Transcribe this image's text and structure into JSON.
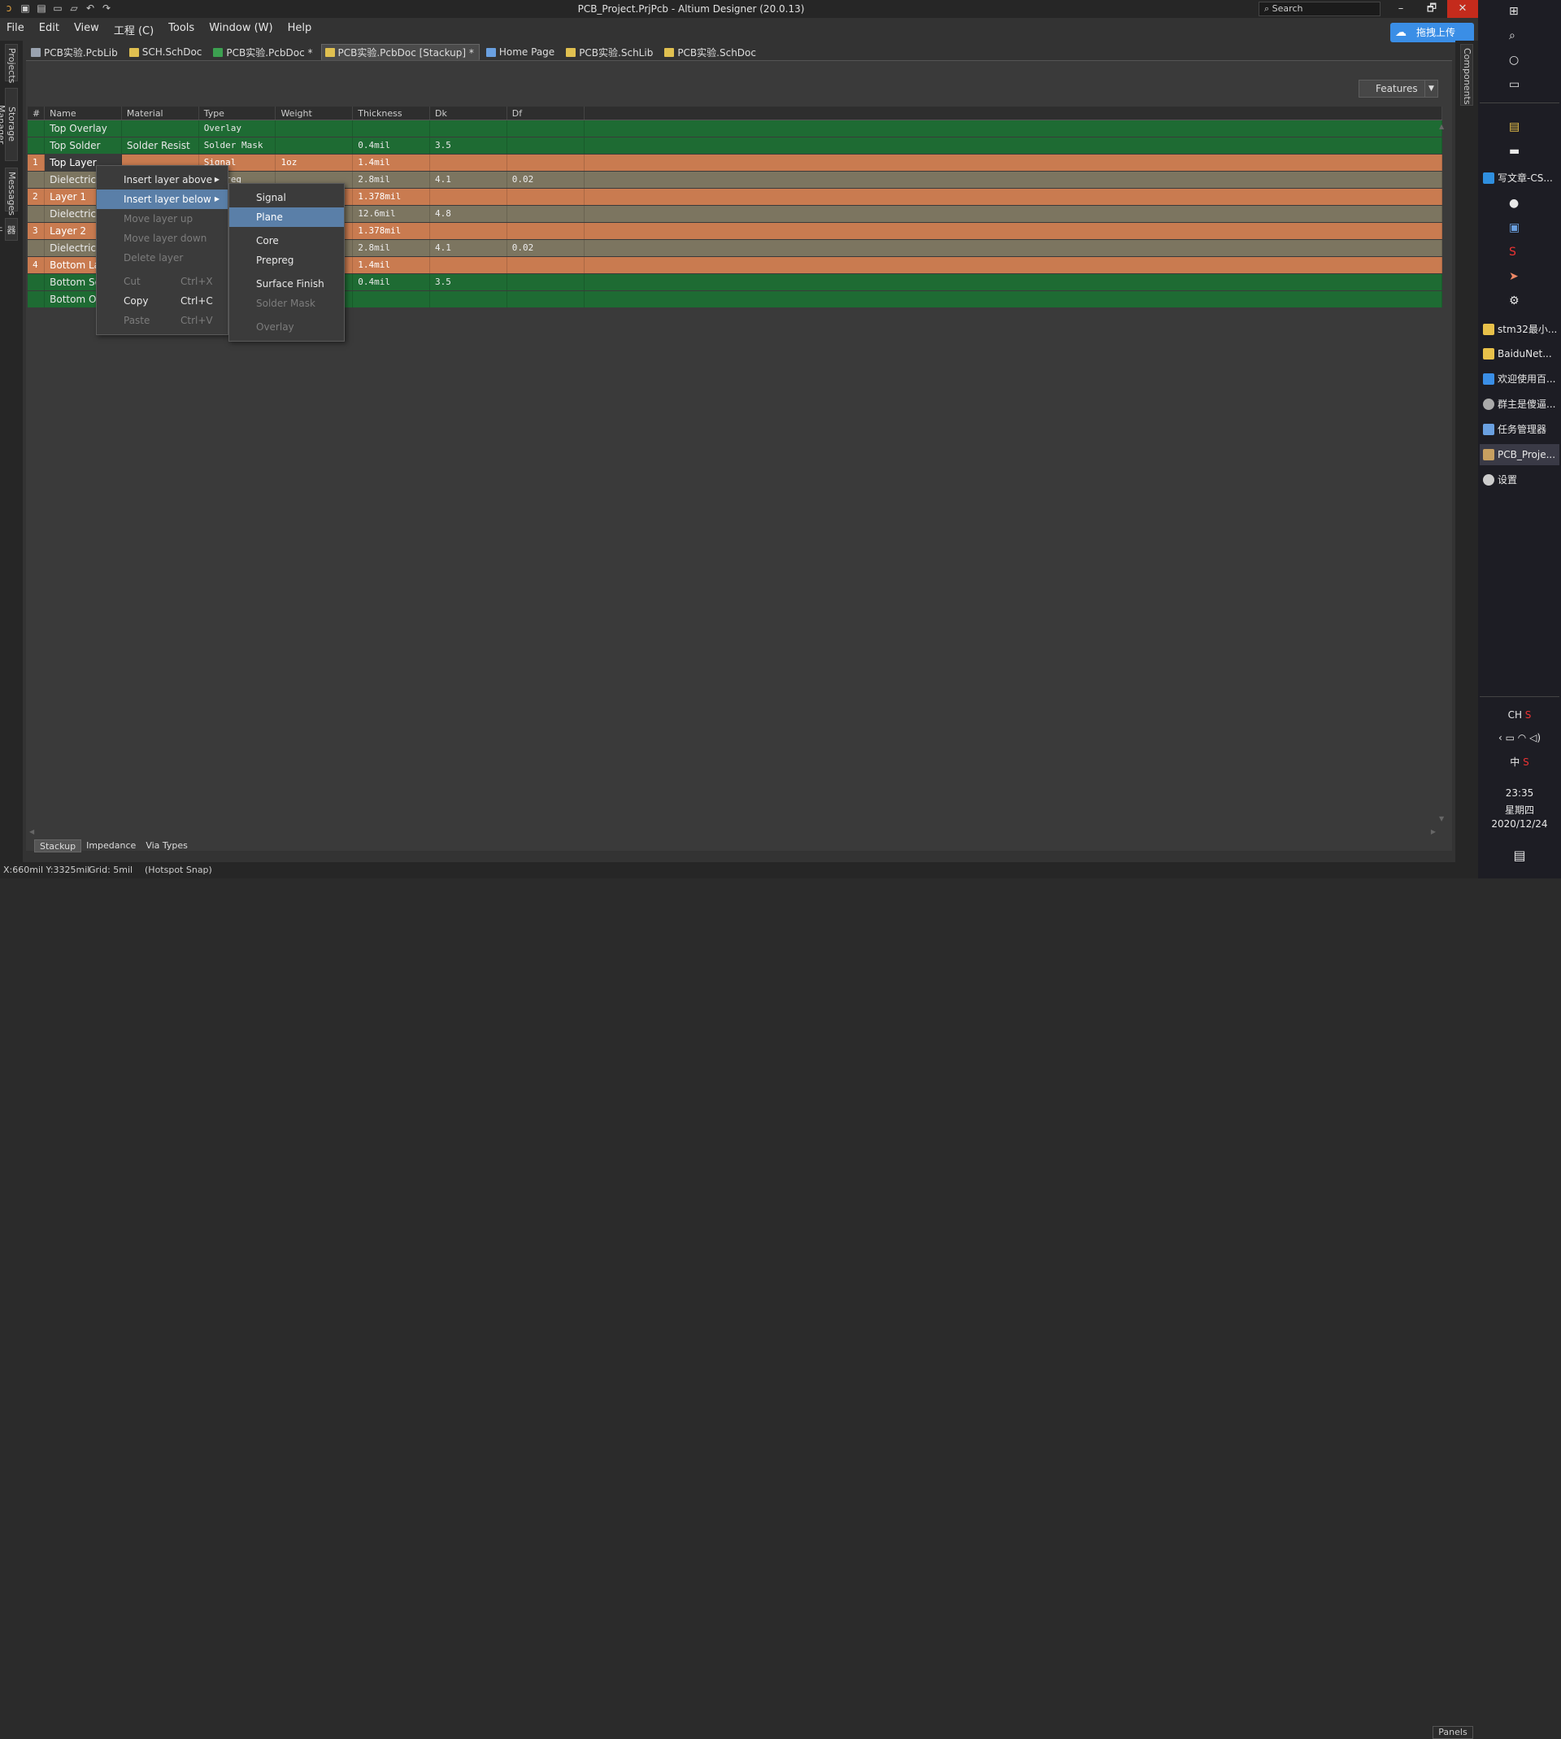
{
  "window": {
    "title": "PCB_Project.PrjPcb - Altium Designer (20.0.13)",
    "search_placeholder": "Search",
    "minimize": "–",
    "restore": "🗗",
    "close": "✕"
  },
  "menu": [
    "File",
    "Edit",
    "View",
    "工程 (C)",
    "Tools",
    "Window (W)",
    "Help"
  ],
  "upload_button": "拖拽上传",
  "left_panels": [
    "Projects",
    "Storage Manager",
    "Messages",
    "器件"
  ],
  "right_panels": [
    "Components"
  ],
  "doc_tabs": [
    {
      "label": "PCB实验.PcbLib",
      "icon": "pcblib-icon",
      "color": "#9aa3b0"
    },
    {
      "label": "SCH.SchDoc",
      "icon": "schdoc-icon",
      "color": "#e0c050"
    },
    {
      "label": "PCB实验.PcbDoc *",
      "icon": "pcbdoc-icon",
      "color": "#3ca050"
    },
    {
      "label": "PCB实验.PcbDoc [Stackup] *",
      "icon": "stackup-icon",
      "color": "#e0c050",
      "active": true
    },
    {
      "label": "Home Page",
      "icon": "home-icon",
      "color": "#6aa0e0"
    },
    {
      "label": "PCB实验.SchLib",
      "icon": "schlib-icon",
      "color": "#e0c050"
    },
    {
      "label": "PCB实验.SchDoc",
      "icon": "schdoc-icon",
      "color": "#e0c050"
    }
  ],
  "features_button": "Features",
  "columns": [
    "#",
    "Name",
    "Material",
    "Type",
    "Weight",
    "Thickness",
    "Dk",
    "Df"
  ],
  "layers": [
    {
      "num": "",
      "name": "Top Overlay",
      "material": "",
      "type": "Overlay",
      "weight": "",
      "thickness": "",
      "dk": "",
      "df": "",
      "style": "g"
    },
    {
      "num": "",
      "name": "Top Solder",
      "material": "Solder Resist",
      "type": "Solder Mask",
      "weight": "",
      "thickness": "0.4mil",
      "dk": "3.5",
      "df": "",
      "style": "g"
    },
    {
      "num": "1",
      "name": "Top Layer",
      "material": "",
      "type": "Signal",
      "weight": "1oz",
      "thickness": "1.4mil",
      "dk": "",
      "df": "",
      "style": "o"
    },
    {
      "num": "",
      "name": "Dielectric 2",
      "material": "",
      "type": "Prepreg",
      "weight": "",
      "thickness": "2.8mil",
      "dk": "4.1",
      "df": "0.02",
      "style": "d"
    },
    {
      "num": "2",
      "name": "Layer 1",
      "material": "",
      "type": "",
      "weight": "",
      "thickness": "1.378mil",
      "dk": "",
      "df": "",
      "style": "o"
    },
    {
      "num": "",
      "name": "Dielectric 1",
      "material": "",
      "type": "",
      "weight": "",
      "thickness": "12.6mil",
      "dk": "4.8",
      "df": "",
      "style": "d"
    },
    {
      "num": "3",
      "name": "Layer 2",
      "material": "",
      "type": "",
      "weight": "",
      "thickness": "1.378mil",
      "dk": "",
      "df": "",
      "style": "o"
    },
    {
      "num": "",
      "name": "Dielectric 3",
      "material": "",
      "type": "",
      "weight": "",
      "thickness": "2.8mil",
      "dk": "4.1",
      "df": "0.02",
      "style": "d"
    },
    {
      "num": "4",
      "name": "Bottom Layer",
      "material": "",
      "type": "",
      "weight": "",
      "thickness": "1.4mil",
      "dk": "",
      "df": "",
      "style": "o"
    },
    {
      "num": "",
      "name": "Bottom Solder",
      "material": "",
      "type": "",
      "weight": "",
      "thickness": "0.4mil",
      "dk": "3.5",
      "df": "",
      "style": "g"
    },
    {
      "num": "",
      "name": "Bottom Overlay",
      "material": "",
      "type": "",
      "weight": "",
      "thickness": "",
      "dk": "",
      "df": "",
      "style": "g"
    }
  ],
  "context_menu": {
    "insert_above": "Insert layer above",
    "insert_below": "Insert layer below",
    "move_up": "Move layer up",
    "move_down": "Move layer down",
    "delete": "Delete layer",
    "cut": "Cut",
    "cut_shortcut": "Ctrl+X",
    "copy": "Copy",
    "copy_shortcut": "Ctrl+C",
    "paste": "Paste",
    "paste_shortcut": "Ctrl+V"
  },
  "submenu": {
    "signal": "Signal",
    "plane": "Plane",
    "core": "Core",
    "prepreg": "Prepreg",
    "surface_finish": "Surface Finish",
    "solder_mask": "Solder Mask",
    "overlay": "Overlay"
  },
  "bottom_tabs": [
    "Stackup",
    "Impedance",
    "Via Types"
  ],
  "status": {
    "coords": "X:660mil Y:3325mil",
    "grid": "Grid: 5mil",
    "snap": "(Hotspot Snap)",
    "panels": "Panels"
  },
  "taskbar": {
    "apps": [
      {
        "label": "写文章-CS...",
        "color": "#2f8fdf"
      },
      {
        "label": "stm32最小...",
        "color": "#e8c14a"
      },
      {
        "label": "BaiduNet...",
        "color": "#e8c14a"
      },
      {
        "label": "欢迎使用百...",
        "color": "#3a8ee6"
      },
      {
        "label": "群主是傻逼...",
        "color": "#aaa"
      },
      {
        "label": "任务管理器",
        "color": "#6aa0e0"
      },
      {
        "label": "PCB_Proje...",
        "color": "#c8a060",
        "active": true
      },
      {
        "label": "设置",
        "color": "#ccc"
      }
    ],
    "ime": "CH",
    "ime2": "中",
    "time": "23:35",
    "weekday": "星期四",
    "date": "2020/12/24"
  }
}
